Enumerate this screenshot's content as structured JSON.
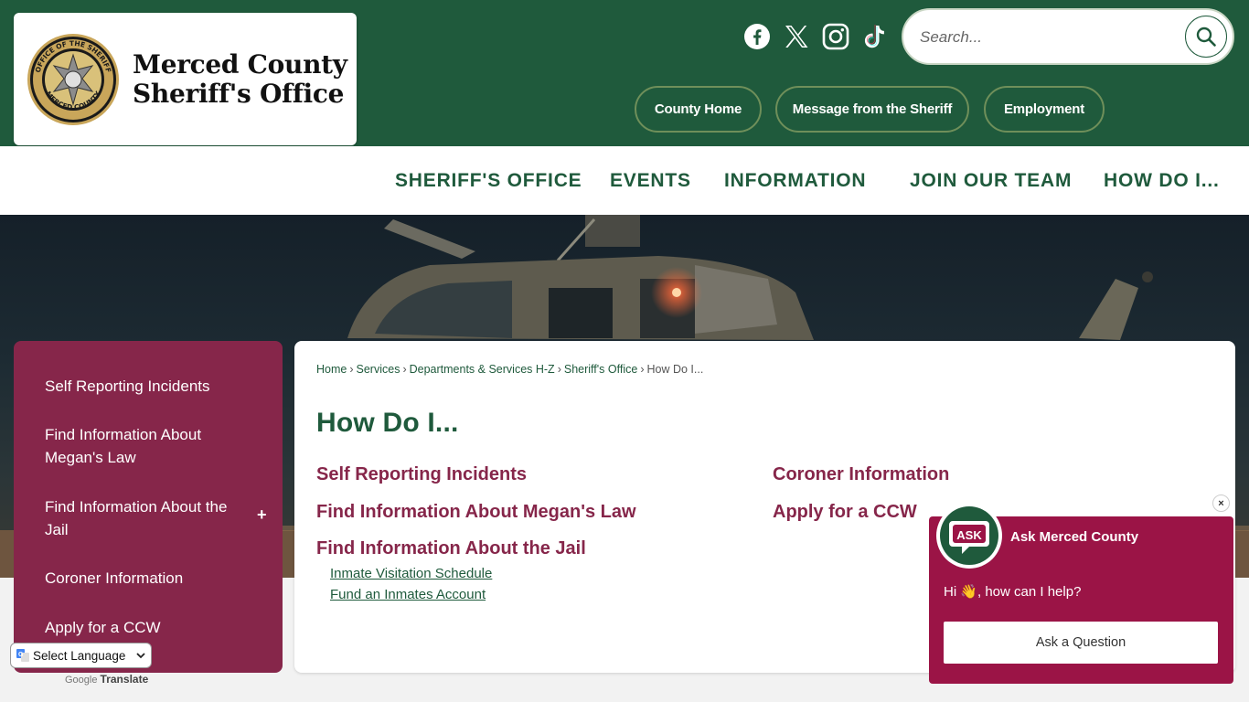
{
  "header": {
    "logo_line1": "Merced County",
    "logo_line2": "Sheriff's Office",
    "seal_text_top": "OFFICE OF THE SHERIFF",
    "seal_text_bottom": "MERCED COUNTY",
    "search_placeholder": "Search...",
    "social": [
      "facebook-icon",
      "x-icon",
      "instagram-icon",
      "tiktok-icon"
    ],
    "quick_links": [
      "County Home",
      "Message from the Sheriff",
      "Employment"
    ]
  },
  "nav": {
    "items": [
      "SHERIFF'S OFFICE",
      "EVENTS",
      "INFORMATION",
      "JOIN OUR TEAM",
      "HOW DO I..."
    ]
  },
  "sidebar": {
    "items": [
      {
        "label": "Self Reporting Incidents"
      },
      {
        "label": "Find Information About Megan's Law"
      },
      {
        "label": "Find Information About the Jail",
        "expand": "+"
      },
      {
        "label": "Coroner Information"
      },
      {
        "label": "Apply for a CCW"
      }
    ]
  },
  "breadcrumb": [
    "Home",
    "Services",
    "Departments & Services H-Z",
    "Sheriff's Office",
    "How Do I..."
  ],
  "page": {
    "title": "How Do I...",
    "links_left": [
      "Self Reporting Incidents",
      "Find Information About Megan's Law",
      "Find Information About the Jail"
    ],
    "sublinks": [
      "Inmate Visitation Schedule",
      "Fund an Inmates Account"
    ],
    "links_right": [
      "Coroner Information",
      "Apply for a CCW"
    ]
  },
  "chat": {
    "avatar_label": "ASK",
    "name": "Ask Merced County",
    "greeting": "Hi 👋, how can I help?",
    "button": "Ask a Question",
    "close": "×"
  },
  "translate": {
    "select_label": "Select Language",
    "powered_by": "Google",
    "translate_word": "Translate"
  },
  "colors": {
    "header_green": "#1f5a3c",
    "maroon": "#86264a",
    "chat_maroon": "#9b1446"
  }
}
